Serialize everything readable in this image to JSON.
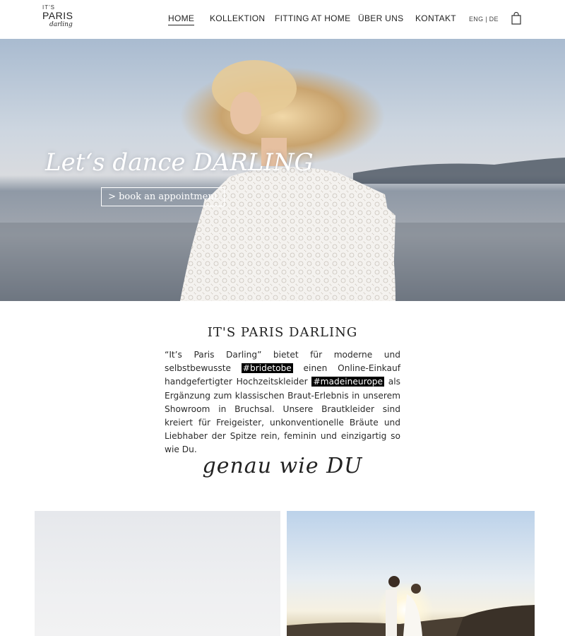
{
  "brand": {
    "small": "IT'S",
    "main": "PARIS",
    "script": "darling"
  },
  "nav": {
    "items": [
      {
        "label": "HOME"
      },
      {
        "label": "KOLLEKTION"
      },
      {
        "label": "FITTING AT HOME"
      },
      {
        "label": "ÜBER UNS"
      },
      {
        "label": "KONTAKT"
      }
    ],
    "language": "ENG | DE",
    "cart_icon": "shopping-bag-icon"
  },
  "hero": {
    "headline": "Let‘s dance DARLING",
    "cta_label": "> book an appointment"
  },
  "about": {
    "title": "IT'S PARIS DARLING",
    "text_1": "“It’s Paris Darling” bietet für moderne und selbstbewusste ",
    "hashtag_1": "#bridetobe",
    "text_2": " einen Online-Einkauf handgefertigter Hochzeitskleider ",
    "hashtag_2": "#madeineurope",
    "text_3": " als Ergänzung zum klassischen Braut-Erlebnis in unserem Showroom in Bruchsal. Unsere Brautkleider sind kreiert für Freigeister, unkonventionelle Bräute und Liebhaber der Spitze rein, feminin und einzigartig so wie Du.",
    "signature": "genau wie DU"
  },
  "colors": {
    "accent": "#000000",
    "text": "#222222",
    "background": "#ffffff"
  }
}
